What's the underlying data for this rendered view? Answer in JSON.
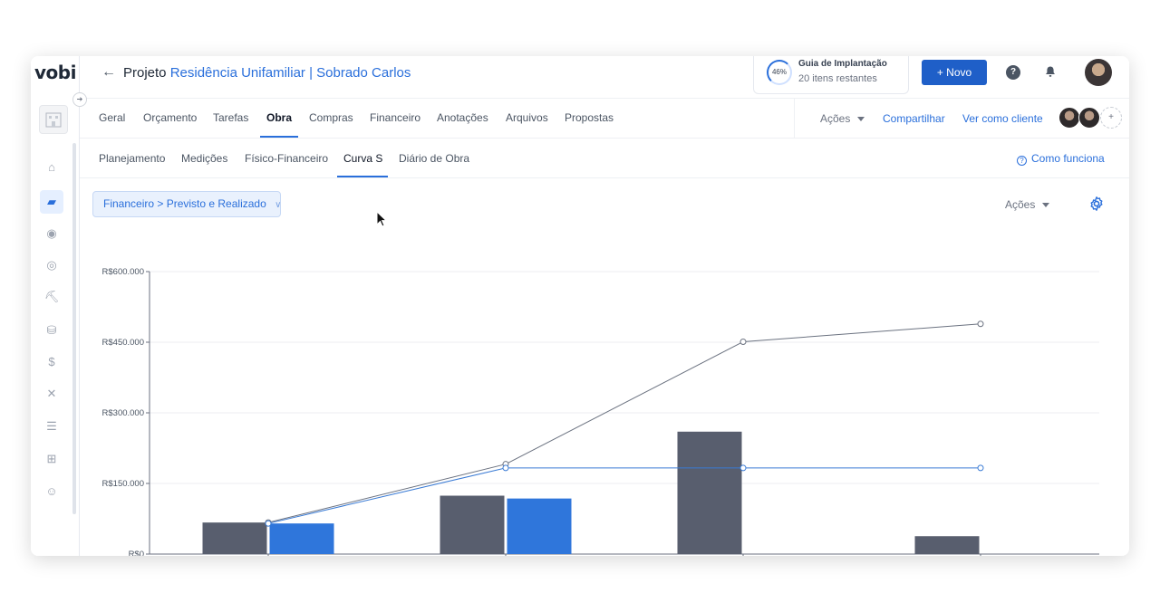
{
  "app": {
    "logo": "vobi"
  },
  "sidebar": {
    "icons": [
      {
        "name": "home-icon",
        "glyph": "⌂",
        "active": false
      },
      {
        "name": "folder-icon",
        "glyph": "▰",
        "active": true
      },
      {
        "name": "handshake-icon",
        "glyph": "◉",
        "active": false
      },
      {
        "name": "compass-icon",
        "glyph": "◎",
        "active": false
      },
      {
        "name": "worker-icon",
        "glyph": "⛏",
        "active": false
      },
      {
        "name": "coins-icon",
        "glyph": "⛁",
        "active": false
      },
      {
        "name": "dollar-icon",
        "glyph": "$",
        "active": false
      },
      {
        "name": "tools-icon",
        "glyph": "✕",
        "active": false
      },
      {
        "name": "list-icon",
        "glyph": "☰",
        "active": false
      },
      {
        "name": "grid-add-icon",
        "glyph": "⊞",
        "active": false
      },
      {
        "name": "team-icon",
        "glyph": "☺",
        "active": false
      }
    ]
  },
  "header": {
    "prefix": "Projeto",
    "project_name": "Residência Unifamiliar | Sobrado Carlos",
    "guide": {
      "percent": "46%",
      "title": "Guia de Implantação",
      "subtitle": "20 itens restantes"
    },
    "new_button": "+ Novo"
  },
  "tabs": [
    {
      "label": "Geral",
      "active": false
    },
    {
      "label": "Orçamento",
      "active": false
    },
    {
      "label": "Tarefas",
      "active": false
    },
    {
      "label": "Obra",
      "active": true
    },
    {
      "label": "Compras",
      "active": false
    },
    {
      "label": "Financeiro",
      "active": false
    },
    {
      "label": "Anotações",
      "active": false
    },
    {
      "label": "Arquivos",
      "active": false
    },
    {
      "label": "Propostas",
      "active": false
    }
  ],
  "tabs_right": {
    "actions": "Ações",
    "share": "Compartilhar",
    "view_as_client": "Ver como cliente"
  },
  "subtabs": [
    {
      "label": "Planejamento",
      "active": false
    },
    {
      "label": "Medições",
      "active": false
    },
    {
      "label": "Físico-Financeiro",
      "active": false
    },
    {
      "label": "Curva S",
      "active": true
    },
    {
      "label": "Diário de Obra",
      "active": false
    }
  ],
  "how_it_works": "Como funciona",
  "filter": {
    "label": "Financeiro > Previsto e Realizado"
  },
  "toolbar": {
    "actions": "Ações"
  },
  "colors": {
    "accent": "#2a6fdb",
    "planned": "#585e6e",
    "realized": "#2f76db",
    "line_planned": "#6b7280",
    "line_realized": "#3a7bd5"
  },
  "chart_data": {
    "type": "bar",
    "ylim": [
      0,
      600000
    ],
    "yticks": [
      0,
      150000,
      300000,
      450000,
      600000
    ],
    "ytick_labels": [
      "R$0",
      "R$150.000",
      "R$300.000",
      "R$450.000",
      "R$600.000"
    ],
    "categories": [
      "",
      "",
      "",
      ""
    ],
    "series": [
      {
        "kind": "bar",
        "values": [
          67000,
          124000,
          260000,
          38000
        ]
      },
      {
        "kind": "bar",
        "values": [
          65000,
          118000,
          0,
          0
        ]
      },
      {
        "kind": "line",
        "values": [
          67000,
          191000,
          451000,
          489000
        ]
      },
      {
        "kind": "line",
        "values": [
          65000,
          183000,
          183000,
          183000
        ]
      }
    ],
    "grid": true
  }
}
